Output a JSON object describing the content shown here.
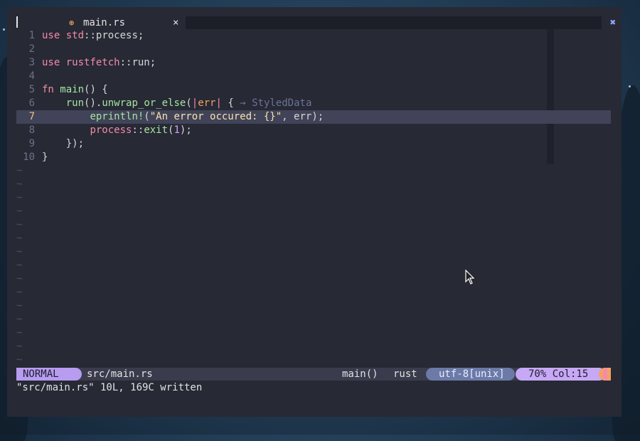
{
  "tabline": {
    "tab_icon": "rust-gear-icon",
    "tab_icon_glyph": "⊛",
    "tab_name": "main.rs",
    "tab_close_glyph": "×",
    "close_all_glyph": "✖"
  },
  "editor": {
    "lines": [
      {
        "num": "1",
        "text": "use std::process;"
      },
      {
        "num": "2",
        "text": ""
      },
      {
        "num": "3",
        "text": "use rustfetch::run;"
      },
      {
        "num": "4",
        "text": ""
      },
      {
        "num": "5",
        "text": "fn main() {"
      },
      {
        "num": "6",
        "text": "    run().unwrap_or_else(|err| {",
        "hint": "→ StyledData"
      },
      {
        "num": "7",
        "text": "        eprintln!(\"An error occured: {}\", err);"
      },
      {
        "num": "8",
        "text": "        process::exit(1);"
      },
      {
        "num": "9",
        "text": "    });"
      },
      {
        "num": "10",
        "text": "}"
      }
    ],
    "current_line": 7,
    "empty_marker": "~"
  },
  "statusline": {
    "mode": "NORMAL",
    "file": "src/main.rs",
    "function": "main()",
    "language": "rust",
    "encoding": "utf-8[unix]",
    "position": "70% Col:15"
  },
  "cmdline": "\"src/main.rs\" 10L, 169C written",
  "colors": {
    "background": "#272935",
    "mode_bg": "#b79cf0",
    "keyword": "#f38ba8",
    "function": "#a6e3a1",
    "string": "#f9e2af"
  }
}
